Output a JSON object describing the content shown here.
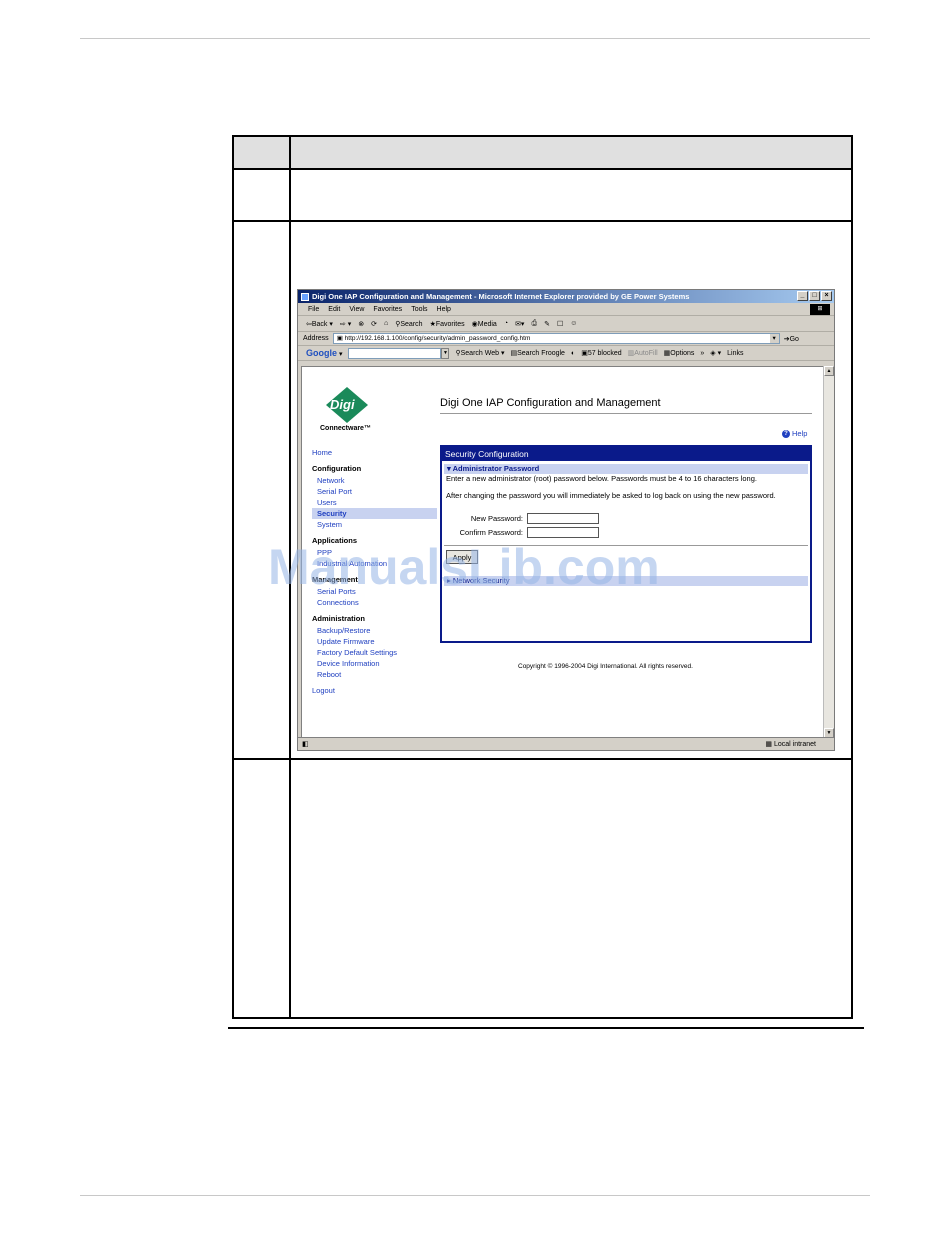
{
  "browser": {
    "title": "Digi One IAP Configuration and Management - Microsoft Internet Explorer provided by GE Power Systems",
    "window_buttons": [
      "_",
      "□",
      "×"
    ],
    "menu": [
      "File",
      "Edit",
      "View",
      "Favorites",
      "Tools",
      "Help"
    ],
    "toolbar": {
      "back": "Back",
      "search": "Search",
      "favorites": "Favorites",
      "media": "Media"
    },
    "address": {
      "label": "Address",
      "url": "http://192.168.1.100/config/security/admin_password_config.htm",
      "go": "Go"
    },
    "google_bar": {
      "logo": "Google",
      "search_web": "Search Web",
      "search_froogle": "Search Froogle",
      "blocked": "57 blocked",
      "autofill": "AutoFill",
      "options": "Options",
      "links": "Links"
    },
    "status": {
      "zone": "Local intranet"
    }
  },
  "page": {
    "logo_text": "Digi",
    "logo_sub": "Connectware™",
    "heading": "Digi One IAP Configuration and Management",
    "help": "Help",
    "nav": {
      "home": "Home",
      "configuration": {
        "title": "Configuration",
        "items": [
          "Network",
          "Serial Port",
          "Users",
          "Security",
          "System"
        ]
      },
      "applications": {
        "title": "Applications",
        "items": [
          "PPP",
          "Industrial Automation"
        ]
      },
      "management": {
        "title": "Management",
        "items": [
          "Serial Ports",
          "Connections"
        ]
      },
      "administration": {
        "title": "Administration",
        "items": [
          "Backup/Restore",
          "Update Firmware",
          "Factory Default Settings",
          "Device Information",
          "Reboot"
        ]
      },
      "logout": "Logout"
    },
    "panel": {
      "title": "Security Configuration",
      "section": "Administrator Password",
      "text1": "Enter a new administrator (root) password below. Passwords must be 4 to 16 characters long.",
      "text2": "After changing the password you will immediately be asked to log back on using the new password.",
      "new_password_label": "New Password:",
      "confirm_password_label": "Confirm Password:",
      "apply": "Apply",
      "network_security": "Network Security"
    },
    "copyright": "Copyright © 1996-2004 Digi International. All rights reserved."
  },
  "watermark": "ManualsLib.com",
  "colors": {
    "panel_blue": "#0a1a8a",
    "link_blue": "#2040c0",
    "section_bg": "#c8d2f0",
    "logo_green": "#1a8a5a"
  }
}
